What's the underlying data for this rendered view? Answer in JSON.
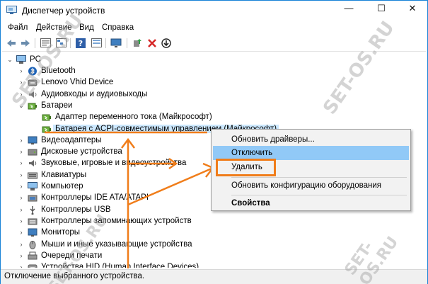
{
  "window": {
    "title": "Диспетчер устройств",
    "controls": {
      "minimize": "—",
      "maximize": "☐",
      "close": "✕"
    }
  },
  "menubar": [
    "Файл",
    "Действие",
    "Вид",
    "Справка"
  ],
  "toolbar": [
    "back-icon",
    "forward-icon",
    "properties-icon",
    "tree-icon",
    "help-icon",
    "list-icon",
    "monitor-icon",
    "update-driver-icon",
    "remove-icon",
    "download-icon"
  ],
  "tree": {
    "root": "PC",
    "nodes": [
      {
        "label": "Bluetooth",
        "icon": "bluetooth-icon"
      },
      {
        "label": "Lenovo Vhid Device",
        "icon": "hid-icon"
      },
      {
        "label": "Аудиовходы и аудиовыходы",
        "icon": "audio-icon"
      },
      {
        "label": "Батареи",
        "icon": "battery-icon",
        "expanded": true
      },
      {
        "label": "Адаптер переменного тока (Майкрософт)",
        "icon": "battery-icon",
        "child": true
      },
      {
        "label": "Батарея с ACPI-совместимым управлением (Майкрософт)",
        "icon": "battery-icon",
        "child": true,
        "selected": true
      },
      {
        "label": "Видеоадаптеры",
        "icon": "display-adapter-icon"
      },
      {
        "label": "Дисковые устройства",
        "icon": "disk-icon"
      },
      {
        "label": "Звуковые, игровые и видеоустройства",
        "icon": "sound-icon"
      },
      {
        "label": "Клавиатуры",
        "icon": "keyboard-icon"
      },
      {
        "label": "Компьютер",
        "icon": "computer-icon"
      },
      {
        "label": "Контроллеры IDE ATA/ATAPI",
        "icon": "ide-icon"
      },
      {
        "label": "Контроллеры USB",
        "icon": "usb-icon"
      },
      {
        "label": "Контроллеры запоминающих устройств",
        "icon": "storage-icon"
      },
      {
        "label": "Мониторы",
        "icon": "monitor-icon"
      },
      {
        "label": "Мыши и иные указывающие устройства",
        "icon": "mouse-icon"
      },
      {
        "label": "Очереди печати",
        "icon": "printer-icon"
      },
      {
        "label": "Устройства HID (Human Interface Devices)",
        "icon": "hid-icon"
      }
    ]
  },
  "context_menu": {
    "items": [
      {
        "label": "Обновить драйверы..."
      },
      {
        "label": "Отключить",
        "hover": true
      },
      {
        "label": "Удалить",
        "highlighted": true
      },
      {
        "label": "Обновить конфигурацию оборудования"
      },
      {
        "label": "Свойства",
        "bold": true
      }
    ]
  },
  "statusbar": {
    "text": "Отключение выбранного устройства."
  },
  "watermark": "SET-OS.RU",
  "colors": {
    "accent": "#1883d7",
    "hover": "#91c9f7",
    "selected": "#cce8ff",
    "annotation": "#f07d1a",
    "green": "#2ea043",
    "red": "#d62828"
  }
}
